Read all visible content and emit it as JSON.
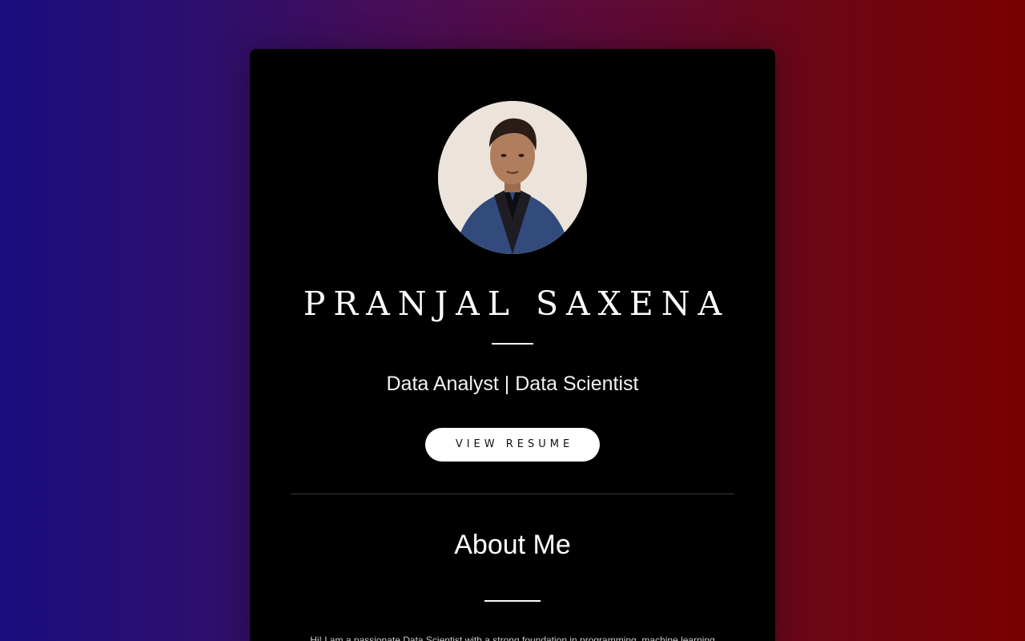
{
  "profile": {
    "name": "PRANJAL SAXENA",
    "title": "Data Analyst | Data Scientist",
    "resume_label": "VIEW RESUME",
    "avatar_icon": "profile-photo"
  },
  "about": {
    "heading": "About Me",
    "text": "Hi! I am a passionate Data Scientist with a strong foundation in programming, machine learning"
  },
  "colors": {
    "card_background": "#000000",
    "gradient_left": "#1a0d7f",
    "gradient_right": "#790000",
    "button_background": "#ffffff"
  }
}
